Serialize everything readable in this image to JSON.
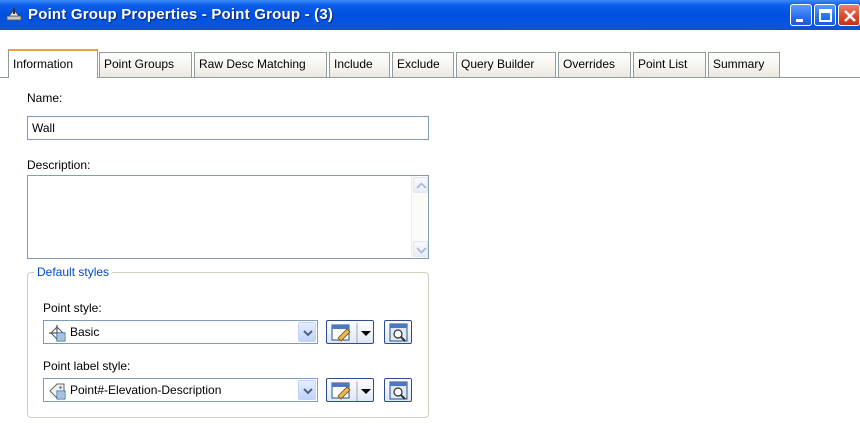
{
  "window": {
    "title": "Point Group Properties - Point Group - (3)"
  },
  "tabs": [
    {
      "label": "Information",
      "active": true
    },
    {
      "label": "Point Groups"
    },
    {
      "label": "Raw Desc Matching"
    },
    {
      "label": "Include"
    },
    {
      "label": "Exclude"
    },
    {
      "label": "Query Builder"
    },
    {
      "label": "Overrides"
    },
    {
      "label": "Point List"
    },
    {
      "label": "Summary"
    }
  ],
  "information": {
    "name_label": "Name:",
    "name_value": "Wall",
    "description_label": "Description:",
    "description_value": "",
    "default_styles": {
      "legend": "Default styles",
      "point_style_label": "Point style:",
      "point_style_value": "Basic",
      "point_label_style_label": "Point label style:",
      "point_label_style_value": "Point#-Elevation-Description"
    }
  },
  "colors": {
    "titlebar": "#0050e0",
    "active_tab_accent": "#e8a436",
    "group_legend": "#0046d5"
  },
  "icons": {
    "title": "surveying-tool-icon",
    "point_style": "point-style-icon",
    "point_label_style": "label-style-icon",
    "edit": "edit-style-icon",
    "preview": "preview-magnifier-icon"
  }
}
